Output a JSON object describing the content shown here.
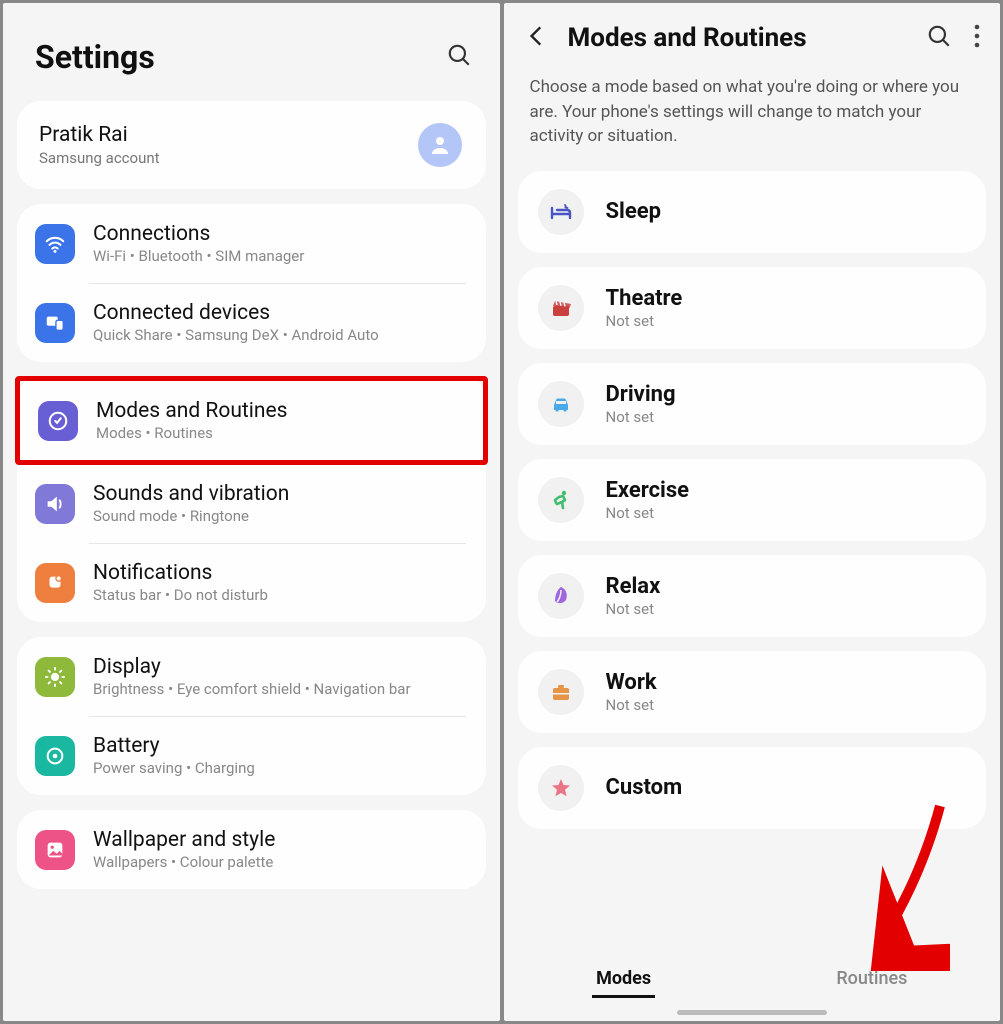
{
  "left": {
    "title": "Settings",
    "account": {
      "name": "Pratik Rai",
      "sub": "Samsung account"
    },
    "groups": [
      [
        {
          "id": "connections",
          "title": "Connections",
          "sub": "Wi-Fi  •  Bluetooth  •  SIM manager",
          "color": "ic-blue",
          "icon": "wifi"
        },
        {
          "id": "connected-devices",
          "title": "Connected devices",
          "sub": "Quick Share  •  Samsung DeX  •  Android Auto",
          "color": "ic-blue2",
          "icon": "devices"
        }
      ],
      [
        {
          "id": "modes-routines",
          "title": "Modes and Routines",
          "sub": "Modes  •  Routines",
          "color": "ic-purple",
          "icon": "target",
          "highlight": true
        },
        {
          "id": "sounds",
          "title": "Sounds and vibration",
          "sub": "Sound mode  •  Ringtone",
          "color": "ic-lavender",
          "icon": "speaker"
        },
        {
          "id": "notifications",
          "title": "Notifications",
          "sub": "Status bar  •  Do not disturb",
          "color": "ic-orange",
          "icon": "bell"
        }
      ],
      [
        {
          "id": "display",
          "title": "Display",
          "sub": "Brightness  •  Eye comfort shield  •  Navigation bar",
          "color": "ic-green",
          "icon": "sun"
        },
        {
          "id": "battery",
          "title": "Battery",
          "sub": "Power saving  •  Charging",
          "color": "ic-teal",
          "icon": "battery"
        }
      ],
      [
        {
          "id": "wallpaper",
          "title": "Wallpaper and style",
          "sub": "Wallpapers  •  Colour palette",
          "color": "ic-pink",
          "icon": "image"
        }
      ]
    ]
  },
  "right": {
    "title": "Modes and Routines",
    "description": "Choose a mode based on what you're doing or where you are. Your phone's settings will change to match your activity or situation.",
    "modes": [
      {
        "id": "sleep",
        "title": "Sleep",
        "sub": "",
        "icon": "bed",
        "color": "#4a54c4"
      },
      {
        "id": "theatre",
        "title": "Theatre",
        "sub": "Not set",
        "icon": "clapper",
        "color": "#c9403e"
      },
      {
        "id": "driving",
        "title": "Driving",
        "sub": "Not set",
        "icon": "car",
        "color": "#4aa9e8"
      },
      {
        "id": "exercise",
        "title": "Exercise",
        "sub": "Not set",
        "icon": "run",
        "color": "#3fbf6f"
      },
      {
        "id": "relax",
        "title": "Relax",
        "sub": "Not set",
        "icon": "leaf",
        "color": "#9d67e0"
      },
      {
        "id": "work",
        "title": "Work",
        "sub": "Not set",
        "icon": "briefcase",
        "color": "#e69446"
      },
      {
        "id": "custom",
        "title": "Custom",
        "sub": "",
        "icon": "star",
        "color": "#ea7587"
      }
    ],
    "tabs": {
      "active": "Modes",
      "inactive": "Routines"
    }
  }
}
